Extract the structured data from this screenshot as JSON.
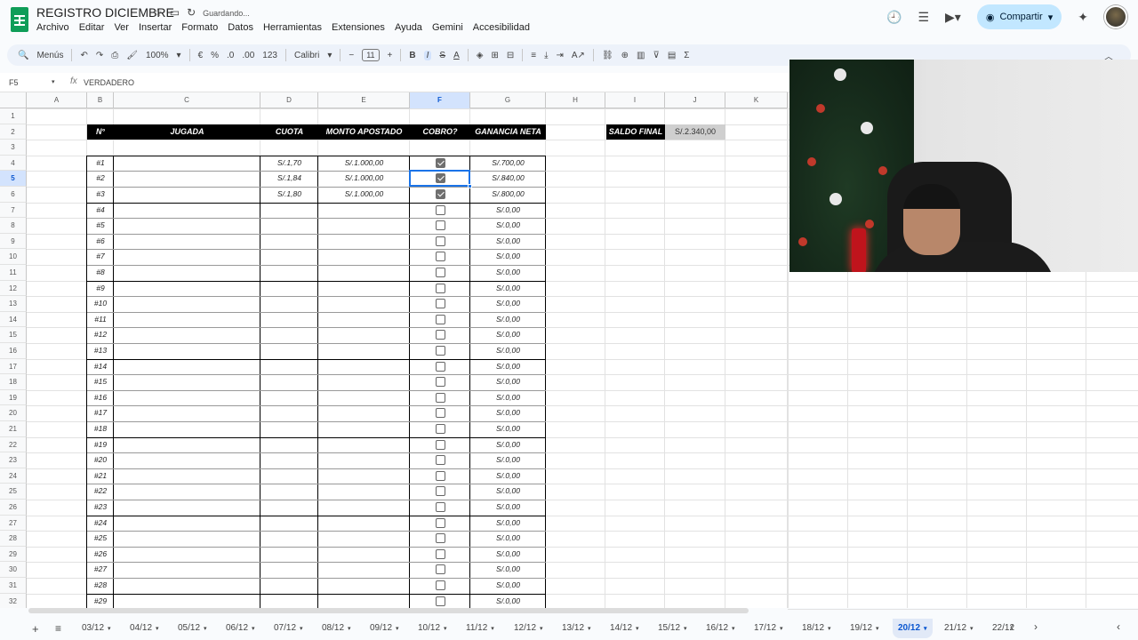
{
  "title_bar": {
    "doc_title": "REGISTRO DICIEMBRE",
    "saving_status": "Guardando...",
    "menu": [
      "Archivo",
      "Editar",
      "Ver",
      "Insertar",
      "Formato",
      "Datos",
      "Herramientas",
      "Extensiones",
      "Ayuda",
      "Gemini",
      "Accesibilidad"
    ],
    "share_label": "Compartir"
  },
  "toolbar": {
    "search_menus": "Menús",
    "zoom": "100%",
    "currency": "€",
    "percent": "%",
    "decimal_decrease": ".0",
    "decimal_increase": ".00",
    "number_format": "123",
    "font": "Calibri",
    "font_size": "11"
  },
  "formula_bar": {
    "name_box": "F5",
    "fx": "fx",
    "value": "VERDADERO"
  },
  "columns": [
    "A",
    "B",
    "C",
    "D",
    "E",
    "F",
    "G",
    "H",
    "I",
    "J",
    "K"
  ],
  "selected_column": "F",
  "selected_row": 5,
  "table": {
    "headers": [
      "N°",
      "JUGADA",
      "CUOTA",
      "MONTO APOSTADO",
      "COBRO?",
      "GANANCIA NETA"
    ],
    "rows": [
      {
        "n": "#1",
        "cuota": "S/.1,70",
        "monto": "S/.1.000,00",
        "cobro": true,
        "ganancia": "S/.700,00"
      },
      {
        "n": "#2",
        "cuota": "S/.1,84",
        "monto": "S/.1.000,00",
        "cobro": true,
        "ganancia": "S/.840,00"
      },
      {
        "n": "#3",
        "cuota": "S/.1,80",
        "monto": "S/.1.000,00",
        "cobro": true,
        "ganancia": "S/.800,00"
      },
      {
        "n": "#4",
        "cuota": "",
        "monto": "",
        "cobro": false,
        "ganancia": "S/.0,00"
      },
      {
        "n": "#5",
        "cuota": "",
        "monto": "",
        "cobro": false,
        "ganancia": "S/.0,00"
      },
      {
        "n": "#6",
        "cuota": "",
        "monto": "",
        "cobro": false,
        "ganancia": "S/.0,00"
      },
      {
        "n": "#7",
        "cuota": "",
        "monto": "",
        "cobro": false,
        "ganancia": "S/.0,00"
      },
      {
        "n": "#8",
        "cuota": "",
        "monto": "",
        "cobro": false,
        "ganancia": "S/.0,00"
      },
      {
        "n": "#9",
        "cuota": "",
        "monto": "",
        "cobro": false,
        "ganancia": "S/.0,00"
      },
      {
        "n": "#10",
        "cuota": "",
        "monto": "",
        "cobro": false,
        "ganancia": "S/.0,00"
      },
      {
        "n": "#11",
        "cuota": "",
        "monto": "",
        "cobro": false,
        "ganancia": "S/.0,00"
      },
      {
        "n": "#12",
        "cuota": "",
        "monto": "",
        "cobro": false,
        "ganancia": "S/.0,00"
      },
      {
        "n": "#13",
        "cuota": "",
        "monto": "",
        "cobro": false,
        "ganancia": "S/.0,00"
      },
      {
        "n": "#14",
        "cuota": "",
        "monto": "",
        "cobro": false,
        "ganancia": "S/.0,00"
      },
      {
        "n": "#15",
        "cuota": "",
        "monto": "",
        "cobro": false,
        "ganancia": "S/.0,00"
      },
      {
        "n": "#16",
        "cuota": "",
        "monto": "",
        "cobro": false,
        "ganancia": "S/.0,00"
      },
      {
        "n": "#17",
        "cuota": "",
        "monto": "",
        "cobro": false,
        "ganancia": "S/.0,00"
      },
      {
        "n": "#18",
        "cuota": "",
        "monto": "",
        "cobro": false,
        "ganancia": "S/.0,00"
      },
      {
        "n": "#19",
        "cuota": "",
        "monto": "",
        "cobro": false,
        "ganancia": "S/.0,00"
      },
      {
        "n": "#20",
        "cuota": "",
        "monto": "",
        "cobro": false,
        "ganancia": "S/.0,00"
      },
      {
        "n": "#21",
        "cuota": "",
        "monto": "",
        "cobro": false,
        "ganancia": "S/.0,00"
      },
      {
        "n": "#22",
        "cuota": "",
        "monto": "",
        "cobro": false,
        "ganancia": "S/.0,00"
      },
      {
        "n": "#23",
        "cuota": "",
        "monto": "",
        "cobro": false,
        "ganancia": "S/.0,00"
      },
      {
        "n": "#24",
        "cuota": "",
        "monto": "",
        "cobro": false,
        "ganancia": "S/.0,00"
      },
      {
        "n": "#25",
        "cuota": "",
        "monto": "",
        "cobro": false,
        "ganancia": "S/.0,00"
      },
      {
        "n": "#26",
        "cuota": "",
        "monto": "",
        "cobro": false,
        "ganancia": "S/.0,00"
      },
      {
        "n": "#27",
        "cuota": "",
        "monto": "",
        "cobro": false,
        "ganancia": "S/.0,00"
      },
      {
        "n": "#28",
        "cuota": "",
        "monto": "",
        "cobro": false,
        "ganancia": "S/.0,00"
      },
      {
        "n": "#29",
        "cuota": "",
        "monto": "",
        "cobro": false,
        "ganancia": "S/.0,00"
      }
    ]
  },
  "saldo": {
    "label": "SALDO FINAL",
    "value": "S/.2.340,00"
  },
  "sheet_tabs": [
    "03/12",
    "04/12",
    "05/12",
    "06/12",
    "07/12",
    "08/12",
    "09/12",
    "10/12",
    "11/12",
    "12/12",
    "13/12",
    "14/12",
    "15/12",
    "16/12",
    "17/12",
    "18/12",
    "19/12",
    "20/12",
    "21/12",
    "22/12"
  ],
  "active_tab": "20/12"
}
